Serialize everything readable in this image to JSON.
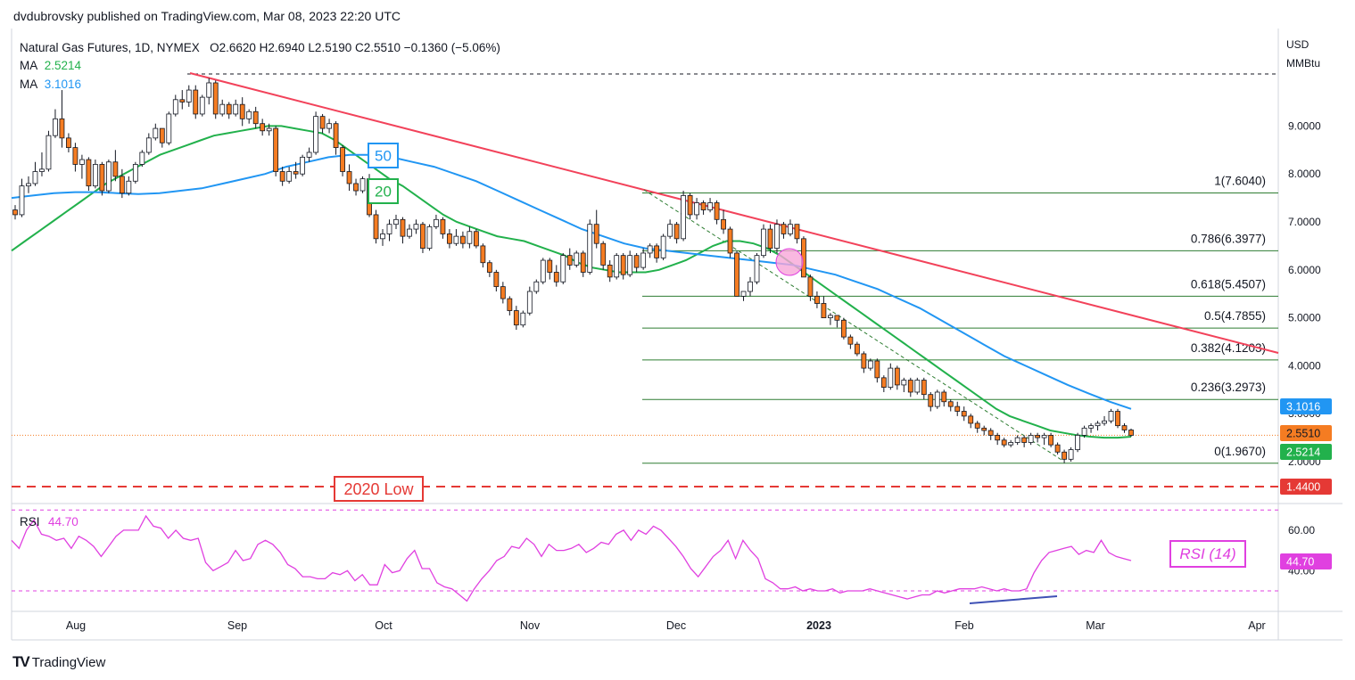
{
  "header": {
    "publisher": "dvdubrovsky published on TradingView.com, Mar 08, 2023 22:20 UTC"
  },
  "legend": {
    "symbol": "Natural Gas Futures, 1D, NYMEX",
    "ohlc": "O2.6620  H2.6940  L2.5190  C2.5510  −0.1360 (−5.06%)",
    "ma_label": "MA",
    "ma20_value": "2.5214",
    "ma50_value": "3.1016"
  },
  "brand": {
    "text": "TradingView",
    "logo": "TV"
  },
  "colors": {
    "ma20": "#22b14c",
    "ma50": "#2196f3",
    "trendline": "#f2425a",
    "rsi": "#e040e0",
    "candle_up": "#ffffff",
    "candle_down": "#f57c22",
    "fib": "#2e7d32",
    "low_line": "#e53935"
  },
  "chart_data": {
    "type": "candlestick",
    "ylabel_unit": "USD",
    "ylabel_unit2": "MMBtu",
    "ylim": [
      1.3,
      10.3
    ],
    "y_ticks": [
      "2.0000",
      "3.0000",
      "4.0000",
      "5.0000",
      "6.0000",
      "7.0000",
      "8.0000",
      "9.0000"
    ],
    "x_ticks": [
      "Aug",
      "Sep",
      "Oct",
      "Nov",
      "Dec",
      "2023",
      "Feb",
      "Mar",
      "Apr"
    ],
    "price_labels": {
      "ma50": "3.1016",
      "close": "2.5510",
      "ma20": "2.5214",
      "low2020": "1.4400"
    },
    "fib_levels": [
      {
        "ratio": "1",
        "price": 7.604,
        "label": "1(7.6040)"
      },
      {
        "ratio": "0.786",
        "price": 6.3977,
        "label": "0.786(6.3977)"
      },
      {
        "ratio": "0.618",
        "price": 5.4507,
        "label": "0.618(5.4507)"
      },
      {
        "ratio": "0.5",
        "price": 4.7855,
        "label": "0.5(4.7855)"
      },
      {
        "ratio": "0.382",
        "price": 4.1203,
        "label": "0.382(4.1203)"
      },
      {
        "ratio": "0.236",
        "price": 3.2973,
        "label": "0.236(3.2973)"
      },
      {
        "ratio": "0",
        "price": 1.967,
        "label": "0(1.9670)"
      }
    ],
    "annotations": {
      "ma50_box": "50",
      "ma20_box": "20",
      "low_box": "2020 Low",
      "rsi_box": "RSI (14)"
    },
    "rsi": {
      "label": "RSI",
      "value": "44.70",
      "ylim": [
        20,
        80
      ],
      "y_ticks": [
        "60.00",
        "40.00"
      ],
      "bands": [
        70,
        30
      ],
      "values": [
        55,
        51,
        60,
        65,
        58,
        57,
        55,
        56,
        51,
        57,
        55,
        52,
        47,
        52,
        57,
        60,
        60,
        60,
        67,
        62,
        61,
        56,
        60,
        56,
        55,
        56,
        44,
        40,
        42,
        44,
        50,
        45,
        46,
        53,
        55,
        53,
        49,
        43,
        41,
        37,
        37,
        36,
        36,
        39,
        38,
        40,
        35,
        38,
        33,
        33,
        43,
        39,
        40,
        46,
        50,
        41,
        41,
        34,
        32,
        31,
        28,
        25,
        31,
        36,
        40,
        45,
        47,
        52,
        51,
        56,
        53,
        47,
        53,
        50,
        50,
        51,
        53,
        49,
        51,
        54,
        53,
        58,
        60,
        55,
        60,
        58,
        62,
        60,
        56,
        52,
        47,
        41,
        37,
        42,
        47,
        50,
        55,
        46,
        55,
        50,
        46,
        36,
        34,
        31,
        31,
        32,
        30,
        31,
        30,
        30,
        31,
        29,
        30,
        30,
        30,
        31,
        30,
        29,
        28,
        27,
        26,
        27,
        28,
        28,
        30,
        29,
        30,
        31,
        31,
        31,
        32,
        31,
        30,
        31,
        30,
        30,
        31,
        39,
        45,
        49,
        50,
        51,
        52,
        48,
        50,
        49,
        55,
        49,
        47,
        46,
        45
      ]
    },
    "candles": [
      [
        7.25,
        7.35,
        7.05,
        7.15
      ],
      [
        7.15,
        7.9,
        7.1,
        7.75
      ],
      [
        7.75,
        7.95,
        7.6,
        7.8
      ],
      [
        7.8,
        8.25,
        7.75,
        8.05
      ],
      [
        8.05,
        8.45,
        7.95,
        8.1
      ],
      [
        8.1,
        8.9,
        8.05,
        8.8
      ],
      [
        8.8,
        9.35,
        8.75,
        9.15
      ],
      [
        9.15,
        9.75,
        8.55,
        8.75
      ],
      [
        8.75,
        8.85,
        8.45,
        8.55
      ],
      [
        8.55,
        8.65,
        8.05,
        8.2
      ],
      [
        8.2,
        8.4,
        7.9,
        8.3
      ],
      [
        8.3,
        8.35,
        7.65,
        7.75
      ],
      [
        7.75,
        8.3,
        7.7,
        8.2
      ],
      [
        8.2,
        8.25,
        7.55,
        7.65
      ],
      [
        7.65,
        8.3,
        7.6,
        8.25
      ],
      [
        8.25,
        8.5,
        7.85,
        7.95
      ],
      [
        7.95,
        8.1,
        7.5,
        7.6
      ],
      [
        7.6,
        7.95,
        7.55,
        7.85
      ],
      [
        7.85,
        8.25,
        7.8,
        8.2
      ],
      [
        8.2,
        8.5,
        8.15,
        8.45
      ],
      [
        8.45,
        8.85,
        8.4,
        8.75
      ],
      [
        8.75,
        9.05,
        8.7,
        8.95
      ],
      [
        8.95,
        8.95,
        8.55,
        8.65
      ],
      [
        8.65,
        9.3,
        8.6,
        9.25
      ],
      [
        9.25,
        9.65,
        9.2,
        9.55
      ],
      [
        9.55,
        9.75,
        9.35,
        9.5
      ],
      [
        9.5,
        9.85,
        9.4,
        9.75
      ],
      [
        9.75,
        9.85,
        9.15,
        9.25
      ],
      [
        9.25,
        9.65,
        9.2,
        9.6
      ],
      [
        9.6,
        10.0,
        9.45,
        9.9
      ],
      [
        9.9,
        9.95,
        9.15,
        9.25
      ],
      [
        9.25,
        9.55,
        9.2,
        9.45
      ],
      [
        9.45,
        9.5,
        9.15,
        9.25
      ],
      [
        9.25,
        9.55,
        9.2,
        9.45
      ],
      [
        9.45,
        9.6,
        9.0,
        9.15
      ],
      [
        9.15,
        9.35,
        9.05,
        9.3
      ],
      [
        9.3,
        9.4,
        8.95,
        9.05
      ],
      [
        9.05,
        9.15,
        8.8,
        8.9
      ],
      [
        8.9,
        9.05,
        8.8,
        8.95
      ],
      [
        8.95,
        9.0,
        7.95,
        8.05
      ],
      [
        8.05,
        8.15,
        7.75,
        7.85
      ],
      [
        7.85,
        8.15,
        7.8,
        8.05
      ],
      [
        8.05,
        8.25,
        7.9,
        8.0
      ],
      [
        8.0,
        8.4,
        7.95,
        8.35
      ],
      [
        8.35,
        8.55,
        8.25,
        8.45
      ],
      [
        8.45,
        9.3,
        8.4,
        9.2
      ],
      [
        9.2,
        9.25,
        8.85,
        8.95
      ],
      [
        8.95,
        9.15,
        8.85,
        9.05
      ],
      [
        9.05,
        9.1,
        8.4,
        8.55
      ],
      [
        8.55,
        8.6,
        7.95,
        8.05
      ],
      [
        8.05,
        8.2,
        7.65,
        7.8
      ],
      [
        7.8,
        7.9,
        7.55,
        7.65
      ],
      [
        7.65,
        7.95,
        7.6,
        7.9
      ],
      [
        7.9,
        8.0,
        7.1,
        7.15
      ],
      [
        7.15,
        7.25,
        6.55,
        6.65
      ],
      [
        6.65,
        6.85,
        6.5,
        6.75
      ],
      [
        6.75,
        7.05,
        6.6,
        6.95
      ],
      [
        6.95,
        7.15,
        6.85,
        7.05
      ],
      [
        7.05,
        7.1,
        6.55,
        6.7
      ],
      [
        6.7,
        6.95,
        6.65,
        6.85
      ],
      [
        6.85,
        7.05,
        6.75,
        6.95
      ],
      [
        6.95,
        7.0,
        6.35,
        6.45
      ],
      [
        6.45,
        6.95,
        6.4,
        6.9
      ],
      [
        6.9,
        7.15,
        6.85,
        7.05
      ],
      [
        7.05,
        7.1,
        6.65,
        6.75
      ],
      [
        6.75,
        6.85,
        6.45,
        6.55
      ],
      [
        6.55,
        6.85,
        6.5,
        6.7
      ],
      [
        6.7,
        6.8,
        6.45,
        6.55
      ],
      [
        6.55,
        6.9,
        6.45,
        6.8
      ],
      [
        6.8,
        6.85,
        6.45,
        6.5
      ],
      [
        6.5,
        6.55,
        6.05,
        6.15
      ],
      [
        6.15,
        6.2,
        5.85,
        5.95
      ],
      [
        5.95,
        6.0,
        5.55,
        5.65
      ],
      [
        5.65,
        5.75,
        5.3,
        5.4
      ],
      [
        5.4,
        5.45,
        5.05,
        5.15
      ],
      [
        5.15,
        5.25,
        4.75,
        4.85
      ],
      [
        4.85,
        5.15,
        4.8,
        5.1
      ],
      [
        5.1,
        5.65,
        5.05,
        5.55
      ],
      [
        5.55,
        5.8,
        5.5,
        5.75
      ],
      [
        5.75,
        6.25,
        5.7,
        6.2
      ],
      [
        6.2,
        6.25,
        5.8,
        5.95
      ],
      [
        5.95,
        6.1,
        5.65,
        5.75
      ],
      [
        5.75,
        6.35,
        5.7,
        6.3
      ],
      [
        6.3,
        6.45,
        6.0,
        6.1
      ],
      [
        6.1,
        6.4,
        6.05,
        6.35
      ],
      [
        6.35,
        6.4,
        5.85,
        5.95
      ],
      [
        5.95,
        7.05,
        5.9,
        6.95
      ],
      [
        6.95,
        7.25,
        6.45,
        6.55
      ],
      [
        6.55,
        6.6,
        6.0,
        6.1
      ],
      [
        6.1,
        6.2,
        5.75,
        5.85
      ],
      [
        5.85,
        6.35,
        5.8,
        6.3
      ],
      [
        6.3,
        6.35,
        5.8,
        5.9
      ],
      [
        5.9,
        6.4,
        5.85,
        6.3
      ],
      [
        6.3,
        6.35,
        5.95,
        6.05
      ],
      [
        6.05,
        6.45,
        6.0,
        6.35
      ],
      [
        6.35,
        6.55,
        6.25,
        6.5
      ],
      [
        6.5,
        6.55,
        6.15,
        6.25
      ],
      [
        6.25,
        6.75,
        6.2,
        6.7
      ],
      [
        6.7,
        7.05,
        6.65,
        6.95
      ],
      [
        6.95,
        7.0,
        6.55,
        6.65
      ],
      [
        6.65,
        7.65,
        6.6,
        7.55
      ],
      [
        7.55,
        7.6,
        7.05,
        7.15
      ],
      [
        7.15,
        7.5,
        7.05,
        7.4
      ],
      [
        7.4,
        7.45,
        7.15,
        7.25
      ],
      [
        7.25,
        7.5,
        7.2,
        7.4
      ],
      [
        7.4,
        7.45,
        6.95,
        7.05
      ],
      [
        7.05,
        7.25,
        6.75,
        6.85
      ],
      [
        6.85,
        6.9,
        6.25,
        6.35
      ],
      [
        6.35,
        6.4,
        5.55,
        5.45
      ],
      [
        5.45,
        5.55,
        5.35,
        5.55
      ],
      [
        5.55,
        5.85,
        5.45,
        5.75
      ],
      [
        5.75,
        6.35,
        5.7,
        6.3
      ],
      [
        6.3,
        6.95,
        6.25,
        6.85
      ],
      [
        6.85,
        6.95,
        6.35,
        6.45
      ],
      [
        6.45,
        7.05,
        6.35,
        6.95
      ],
      [
        6.95,
        7.0,
        6.65,
        6.75
      ],
      [
        6.75,
        7.05,
        6.7,
        6.95
      ],
      [
        6.95,
        6.95,
        6.55,
        6.65
      ],
      [
        6.65,
        6.7,
        6.05,
        5.85
      ],
      [
        5.85,
        5.9,
        5.35,
        5.45
      ],
      [
        5.45,
        5.55,
        5.2,
        5.3
      ],
      [
        5.3,
        5.45,
        5.05,
        5.0
      ],
      [
        5.0,
        5.1,
        4.85,
        5.05
      ],
      [
        5.05,
        5.05,
        4.8,
        4.95
      ],
      [
        4.95,
        5.0,
        4.55,
        4.6
      ],
      [
        4.6,
        4.65,
        4.35,
        4.45
      ],
      [
        4.45,
        4.5,
        4.2,
        4.25
      ],
      [
        4.25,
        4.3,
        3.85,
        3.95
      ],
      [
        3.95,
        4.15,
        3.9,
        4.1
      ],
      [
        4.1,
        4.15,
        3.65,
        3.75
      ],
      [
        3.75,
        3.8,
        3.45,
        3.55
      ],
      [
        3.55,
        4.05,
        3.5,
        3.95
      ],
      [
        3.95,
        4.0,
        3.5,
        3.6
      ],
      [
        3.6,
        3.75,
        3.45,
        3.7
      ],
      [
        3.7,
        3.75,
        3.35,
        3.45
      ],
      [
        3.45,
        3.75,
        3.4,
        3.7
      ],
      [
        3.7,
        3.75,
        3.3,
        3.4
      ],
      [
        3.4,
        3.45,
        3.05,
        3.15
      ],
      [
        3.15,
        3.5,
        3.1,
        3.45
      ],
      [
        3.45,
        3.5,
        3.15,
        3.25
      ],
      [
        3.25,
        3.3,
        3.05,
        3.15
      ],
      [
        3.15,
        3.25,
        2.95,
        3.05
      ],
      [
        3.05,
        3.15,
        2.85,
        2.95
      ],
      [
        2.95,
        3.0,
        2.7,
        2.8
      ],
      [
        2.8,
        2.85,
        2.6,
        2.7
      ],
      [
        2.7,
        2.75,
        2.55,
        2.65
      ],
      [
        2.65,
        2.7,
        2.45,
        2.55
      ],
      [
        2.55,
        2.6,
        2.35,
        2.45
      ],
      [
        2.45,
        2.5,
        2.3,
        2.35
      ],
      [
        2.35,
        2.45,
        2.3,
        2.4
      ],
      [
        2.4,
        2.55,
        2.35,
        2.5
      ],
      [
        2.5,
        2.55,
        2.3,
        2.4
      ],
      [
        2.4,
        2.6,
        2.35,
        2.55
      ],
      [
        2.55,
        2.6,
        2.4,
        2.5
      ],
      [
        2.5,
        2.6,
        2.35,
        2.55
      ],
      [
        2.55,
        2.6,
        2.3,
        2.35
      ],
      [
        2.35,
        2.4,
        2.15,
        2.2
      ],
      [
        2.2,
        2.25,
        1.97,
        2.05
      ],
      [
        2.05,
        2.3,
        2.0,
        2.25
      ],
      [
        2.25,
        2.6,
        2.2,
        2.55
      ],
      [
        2.55,
        2.75,
        2.5,
        2.7
      ],
      [
        2.7,
        2.8,
        2.6,
        2.75
      ],
      [
        2.75,
        2.85,
        2.65,
        2.8
      ],
      [
        2.8,
        2.95,
        2.75,
        2.85
      ],
      [
        2.85,
        3.1,
        2.8,
        3.05
      ],
      [
        3.05,
        3.1,
        2.7,
        2.75
      ],
      [
        2.75,
        2.8,
        2.6,
        2.66
      ],
      [
        2.66,
        2.69,
        2.52,
        2.55
      ]
    ],
    "ma20": [
      6.4,
      6.6,
      6.8,
      7.0,
      7.2,
      7.4,
      7.6,
      7.8,
      7.95,
      8.1,
      8.25,
      8.4,
      8.5,
      8.6,
      8.7,
      8.8,
      8.85,
      8.9,
      8.95,
      9.0,
      9.0,
      8.95,
      8.9,
      8.85,
      8.7,
      8.5,
      8.3,
      8.1,
      7.9,
      7.75,
      7.55,
      7.35,
      7.15,
      7.0,
      6.9,
      6.8,
      6.7,
      6.65,
      6.6,
      6.5,
      6.4,
      6.3,
      6.15,
      6.05,
      6.0,
      5.95,
      5.95,
      5.95,
      6.0,
      6.1,
      6.2,
      6.35,
      6.5,
      6.6,
      6.6,
      6.55,
      6.45,
      6.3,
      6.1,
      5.9,
      5.7,
      5.5,
      5.3,
      5.1,
      4.9,
      4.7,
      4.5,
      4.3,
      4.1,
      3.9,
      3.7,
      3.5,
      3.3,
      3.1,
      2.95,
      2.85,
      2.75,
      2.65,
      2.6,
      2.55,
      2.52,
      2.5,
      2.5,
      2.52
    ],
    "ma50": [
      7.5,
      7.55,
      7.6,
      7.62,
      7.62,
      7.6,
      7.58,
      7.6,
      7.65,
      7.7,
      7.8,
      7.9,
      8.0,
      8.15,
      8.25,
      8.35,
      8.4,
      8.4,
      8.35,
      8.25,
      8.15,
      8.0,
      7.85,
      7.65,
      7.45,
      7.25,
      7.05,
      6.85,
      6.7,
      6.55,
      6.45,
      6.4,
      6.35,
      6.3,
      6.25,
      6.2,
      6.15,
      6.1,
      6.0,
      5.9,
      5.75,
      5.6,
      5.4,
      5.2,
      4.95,
      4.7,
      4.45,
      4.2,
      4.0,
      3.8,
      3.6,
      3.42,
      3.25,
      3.1
    ]
  }
}
